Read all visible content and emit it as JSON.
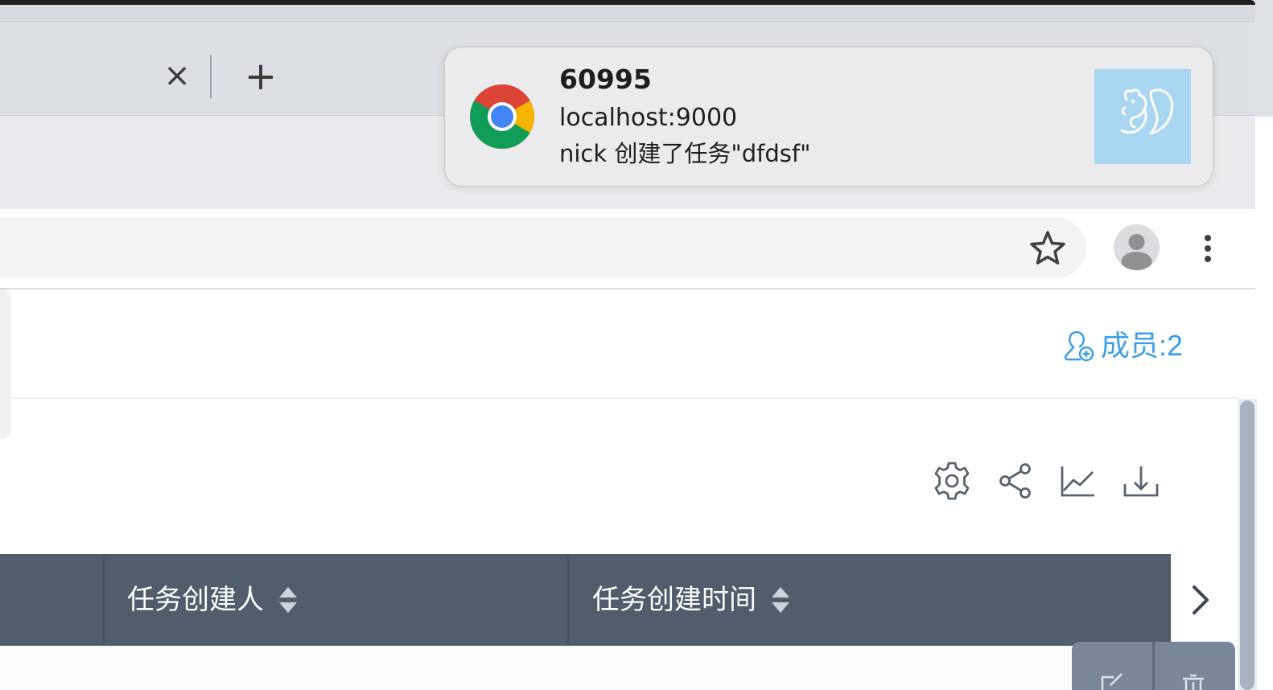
{
  "browser": {
    "tab_close_icon": "×",
    "new_tab_icon": "+",
    "bookmark_icon": "star-outline",
    "profile_icon": "person",
    "menu_icon": "kebab-vertical"
  },
  "notification": {
    "title": "60995",
    "origin": "localhost:9000",
    "message": "nick 创建了任务\"dfdsf\"",
    "app_icon": "chrome",
    "image_icon": "squirrel"
  },
  "page": {
    "members_label": "成员:2",
    "members_icon": "user-add",
    "accent_color": "#3d9ee9",
    "toolbar_icons": [
      "settings-gear",
      "share",
      "line-chart",
      "download"
    ]
  },
  "table": {
    "header_bg": "#515d6d",
    "columns": [
      {
        "label": "任务创建人",
        "sortable": true
      },
      {
        "label": "任务创建时间",
        "sortable": true
      }
    ],
    "next_icon": "chevron-right",
    "row_actions": [
      "edit",
      "delete"
    ]
  }
}
